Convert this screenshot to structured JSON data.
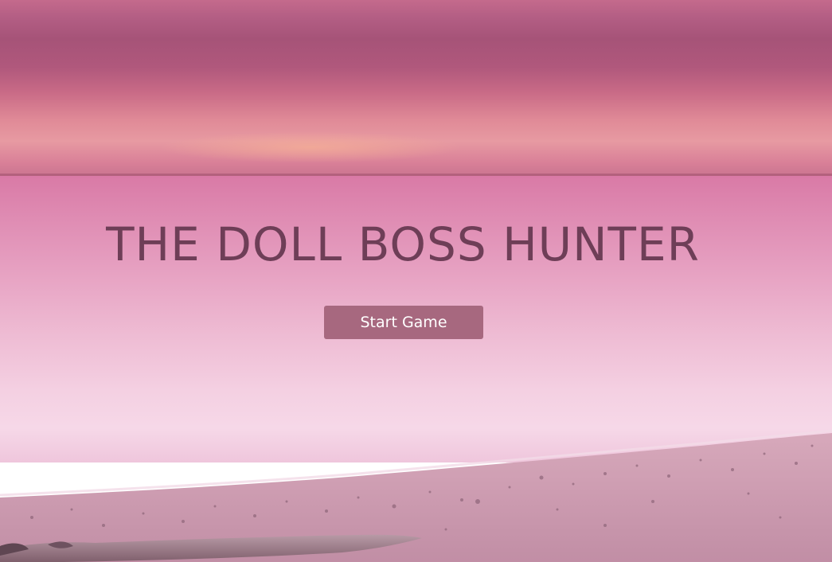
{
  "game": {
    "title": "THE DOLL BOSS HUNTER",
    "start_label": "Start Game"
  },
  "colors": {
    "title": "#6e3e57",
    "button_bg": "#a7687f",
    "button_text": "#ffffff"
  }
}
